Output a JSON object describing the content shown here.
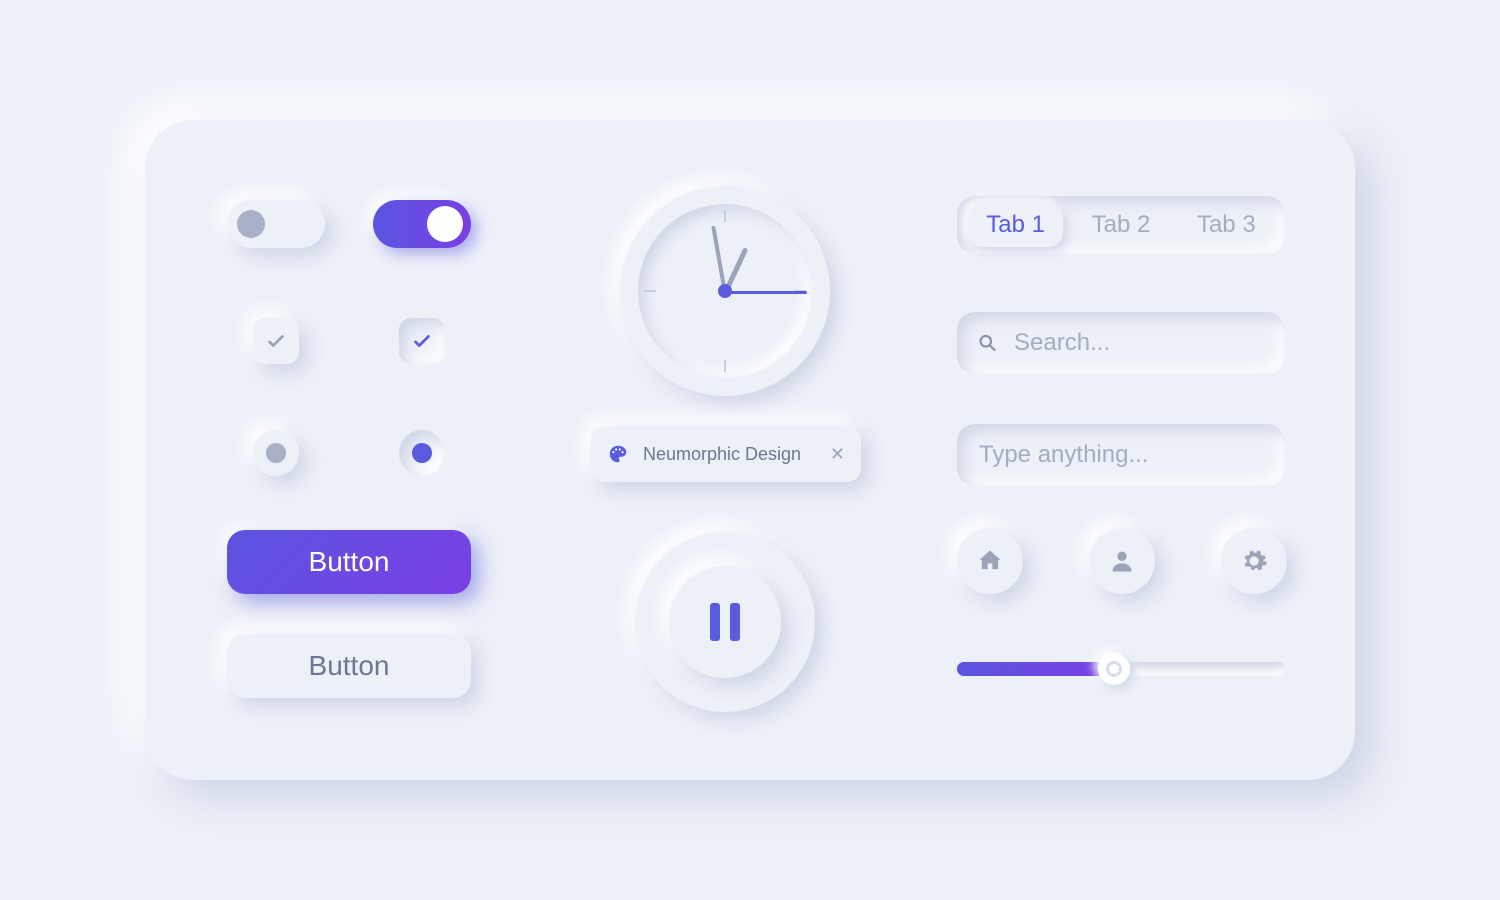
{
  "toggles": {
    "off": false,
    "on": true
  },
  "checkboxes": {
    "grey_checked": true,
    "accent_checked": true
  },
  "radios": {
    "grey_selected": true,
    "accent_selected": true
  },
  "buttons": {
    "primary_label": "Button",
    "secondary_label": "Button"
  },
  "chip": {
    "label": "Neumorphic Design"
  },
  "tabs": {
    "items": [
      "Tab 1",
      "Tab 2",
      "Tab 3"
    ],
    "active_index": 0
  },
  "search": {
    "placeholder": "Search..."
  },
  "text_input": {
    "placeholder": "Type anything..."
  },
  "slider": {
    "percent": 48
  },
  "clock": {
    "hour_deg": -65,
    "minute_deg": -100,
    "second_deg": 0
  },
  "colors": {
    "accent": "#5b5be0",
    "accent2": "#7a4de0",
    "bg": "#ecf0f7",
    "muted": "#a4acc0"
  }
}
